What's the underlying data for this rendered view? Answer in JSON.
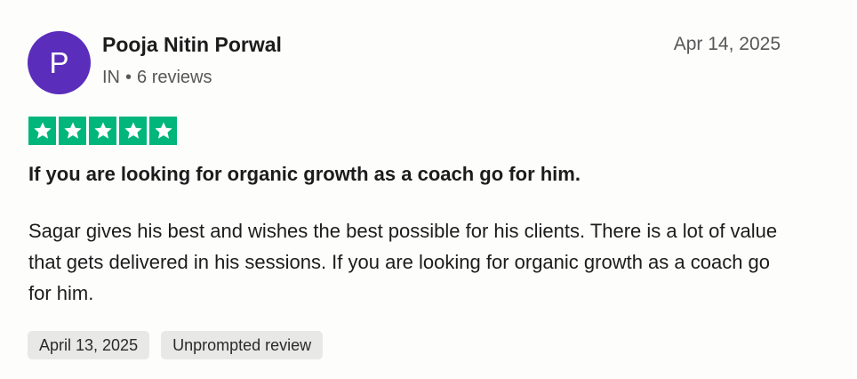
{
  "reviewer": {
    "avatar_initial": "P",
    "avatar_color": "#5a2dbb",
    "name": "Pooja Nitin Porwal",
    "country": "IN",
    "separator": "•",
    "reviews_count": "6 reviews"
  },
  "review": {
    "date": "Apr 14, 2025",
    "rating": 5,
    "rating_max": 5,
    "star_color": "#00b67a",
    "star_icon": "star-icon",
    "title": "If you are looking for organic growth as a coach go for him.",
    "body": "Sagar gives his best and wishes the best possible for his clients. There is a lot of value that gets delivered in his sessions. If you are looking for organic growth as a coach go for him.",
    "experience_date": "April 13, 2025",
    "tag": "Unprompted review"
  }
}
